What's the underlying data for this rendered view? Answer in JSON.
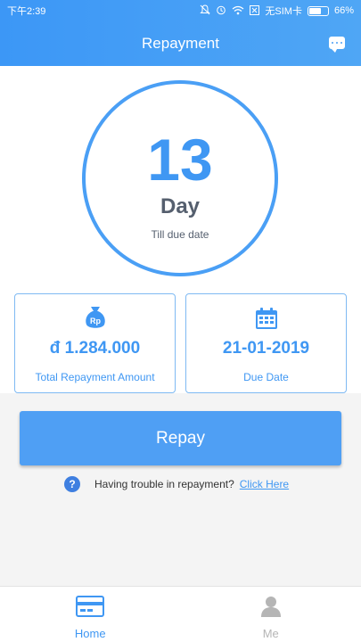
{
  "status_bar": {
    "time": "下午2:39",
    "sim_text": "无SIM卡",
    "battery": "66%"
  },
  "header": {
    "title": "Repayment"
  },
  "countdown": {
    "number": "13",
    "unit": "Day",
    "caption": "Till due date"
  },
  "cards": {
    "amount": {
      "value": "đ 1.284.000",
      "label": "Total Repayment Amount",
      "icon": "money-bag-icon",
      "icon_text": "Rp"
    },
    "due": {
      "value": "21-01-2019",
      "label": "Due Date",
      "icon": "calendar-icon"
    }
  },
  "repay_button": {
    "label": "Repay"
  },
  "help": {
    "text": "Having trouble in repayment?",
    "link": "Click Here"
  },
  "bottom_nav": {
    "items": [
      {
        "label": "Home",
        "icon": "card-icon",
        "active": true
      },
      {
        "label": "Me",
        "icon": "user-icon",
        "active": false
      }
    ]
  },
  "colors": {
    "accent": "#4a9ff5",
    "text_dark": "#555f6e",
    "inactive": "#b5b5b5"
  }
}
